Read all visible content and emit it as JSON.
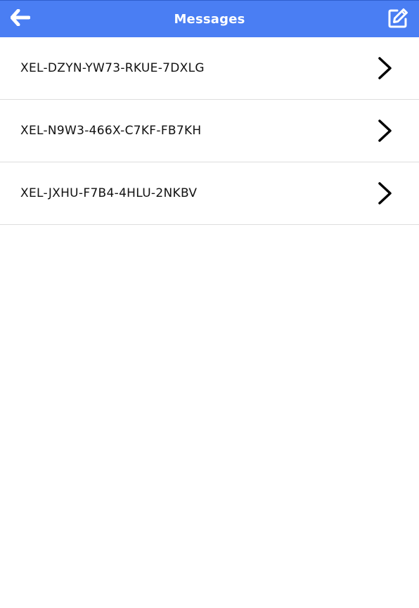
{
  "header": {
    "title": "Messages",
    "back_icon": "arrow-left-icon",
    "compose_icon": "edit-compose-icon",
    "background": "#4a7ef3"
  },
  "messages": [
    {
      "label": "XEL-DZYN-YW73-RKUE-7DXLG",
      "icon": "chevron-right-icon"
    },
    {
      "label": "XEL-N9W3-466X-C7KF-FB7KH",
      "icon": "chevron-right-icon"
    },
    {
      "label": "XEL-JXHU-F7B4-4HLU-2NKBV",
      "icon": "chevron-right-icon"
    }
  ]
}
